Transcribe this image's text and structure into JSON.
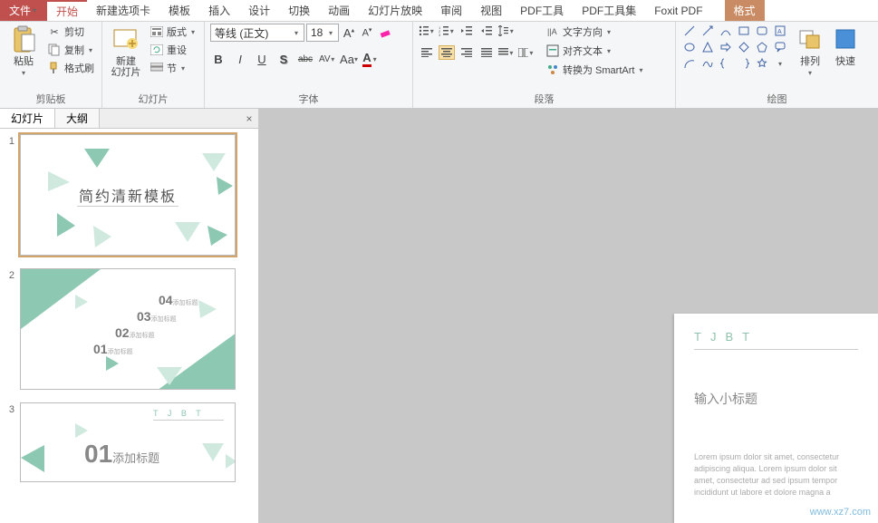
{
  "menu": {
    "file": "文件",
    "home": "开始",
    "newtab": "新建选项卡",
    "template": "模板",
    "insert": "插入",
    "design": "设计",
    "transition": "切换",
    "animation": "动画",
    "slideshow": "幻灯片放映",
    "review": "审阅",
    "view": "视图",
    "pdftool": "PDF工具",
    "pdftoolset": "PDF工具集",
    "foxit": "Foxit PDF",
    "format": "格式"
  },
  "ribbon_groups": {
    "clipboard": "剪贴板",
    "slides": "幻灯片",
    "font": "字体",
    "paragraph": "段落",
    "drawing": "绘图"
  },
  "clipboard": {
    "paste": "粘贴",
    "cut": "剪切",
    "copy": "复制",
    "format_painter": "格式刷"
  },
  "slides": {
    "new_slide": "新建\n幻灯片",
    "layout": "版式",
    "reset": "重设",
    "section": "节"
  },
  "font": {
    "name": "等线 (正文)",
    "size": "18",
    "bold": "B",
    "italic": "I",
    "underline": "U",
    "shadow": "S",
    "strike": "abc",
    "spacing": "AV",
    "changecase": "Aa"
  },
  "paragraph": {
    "text_direction": "文字方向",
    "align_text": "对齐文本",
    "smartart": "转换为 SmartArt"
  },
  "drawing": {
    "arrange": "排列",
    "quick": "快速"
  },
  "leftpane": {
    "tab_slides": "幻灯片",
    "tab_outline": "大纲"
  },
  "thumbs": {
    "n1": "1",
    "n2": "2",
    "n3": "3",
    "s1_title": "简约清新模板",
    "s2_04": "04",
    "s2_03": "03",
    "s2_02": "02",
    "s2_01": "01",
    "s2_t": "添加标题",
    "s3_01": "01",
    "s3_t": "添加标题",
    "s3_tj": "T J B T"
  },
  "slide": {
    "tj": "TJBT",
    "subtitle": "输入小标题",
    "lorem": "Lorem ipsum dolor sit amet, consectetur adipiscing aliqua. Lorem ipsum dolor sit amet, consectetur ad sed ipsum tempor incididunt ut labore et dolore magna a"
  },
  "watermark": "www.xz7.com"
}
